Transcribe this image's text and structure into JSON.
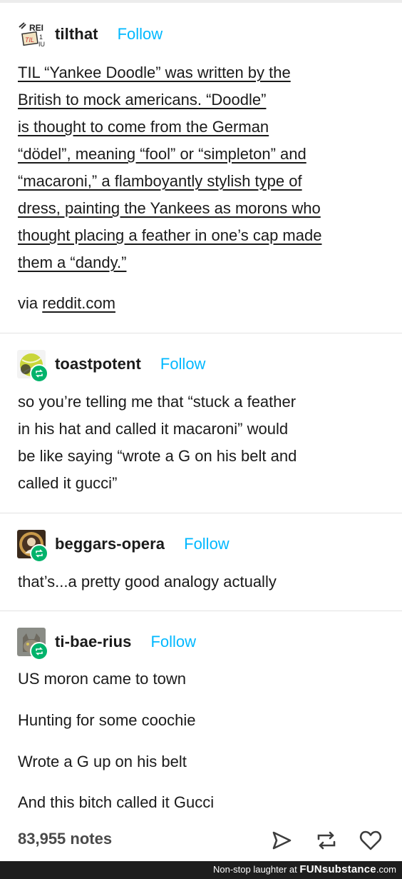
{
  "posts": [
    {
      "username": "tilthat",
      "follow": "Follow",
      "lines": [
        "TIL “Yankee Doodle” was written by the",
        "British to mock americans. “Doodle”",
        "is thought to come from the German",
        "“dödel”, meaning “fool” or “simpleton” and",
        "“macaroni,” a flamboyantly stylish type of",
        "dress, painting the Yankees as morons who",
        "thought placing a feather in one’s cap made",
        "them a “dandy.”"
      ],
      "via_prefix": "via",
      "via_link": "reddit.com",
      "avatar_icon": "newspaper-icon"
    },
    {
      "username": "toastpotent",
      "follow": "Follow",
      "lines": [
        "so you’re telling me that “stuck a feather",
        "in his hat and called it macaroni” would",
        "be like saying “wrote a G on his belt and",
        "called it gucci”"
      ],
      "avatar_icon": "tennis-ball-icon"
    },
    {
      "username": "beggars-opera",
      "follow": "Follow",
      "lines": [
        "that’s...a pretty good analogy actually"
      ],
      "avatar_icon": "portrait-icon"
    },
    {
      "username": "ti-bae-rius",
      "follow": "Follow",
      "lines": [
        "US moron came to town",
        "Hunting for some coochie",
        "Wrote a G up on his belt",
        "And this bitch called it Gucci"
      ],
      "avatar_icon": "cat-icon"
    }
  ],
  "notes": "83,955 notes",
  "footer": {
    "prefix": "Non-stop laughter at",
    "brand": "FUNsubstance",
    "suffix": ".com"
  },
  "colors": {
    "follow": "#00b8ff",
    "reblog_badge": "#00b36b",
    "footer_bg": "#1e1e1e"
  }
}
